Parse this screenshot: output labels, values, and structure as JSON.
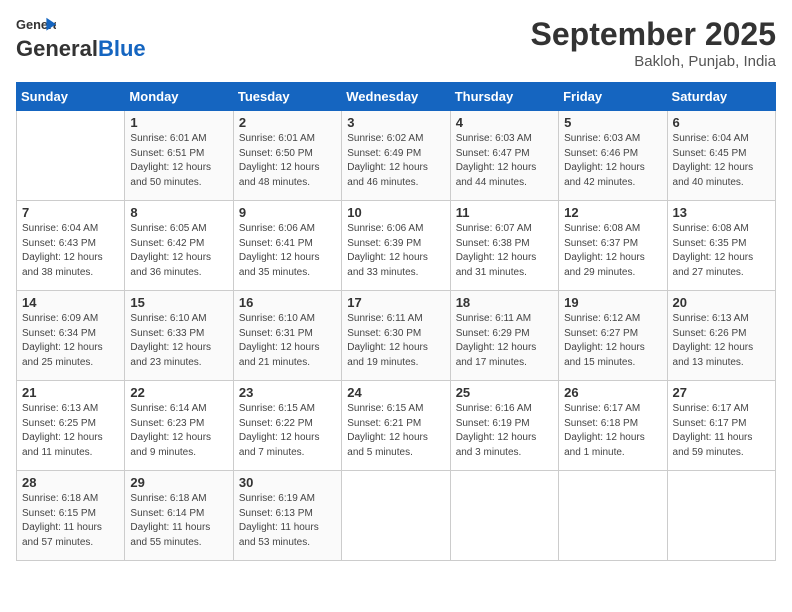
{
  "header": {
    "logo_general": "General",
    "logo_blue": "Blue",
    "month": "September 2025",
    "location": "Bakloh, Punjab, India"
  },
  "days_of_week": [
    "Sunday",
    "Monday",
    "Tuesday",
    "Wednesday",
    "Thursday",
    "Friday",
    "Saturday"
  ],
  "weeks": [
    [
      {
        "day": "",
        "info": ""
      },
      {
        "day": "1",
        "info": "Sunrise: 6:01 AM\nSunset: 6:51 PM\nDaylight: 12 hours\nand 50 minutes."
      },
      {
        "day": "2",
        "info": "Sunrise: 6:01 AM\nSunset: 6:50 PM\nDaylight: 12 hours\nand 48 minutes."
      },
      {
        "day": "3",
        "info": "Sunrise: 6:02 AM\nSunset: 6:49 PM\nDaylight: 12 hours\nand 46 minutes."
      },
      {
        "day": "4",
        "info": "Sunrise: 6:03 AM\nSunset: 6:47 PM\nDaylight: 12 hours\nand 44 minutes."
      },
      {
        "day": "5",
        "info": "Sunrise: 6:03 AM\nSunset: 6:46 PM\nDaylight: 12 hours\nand 42 minutes."
      },
      {
        "day": "6",
        "info": "Sunrise: 6:04 AM\nSunset: 6:45 PM\nDaylight: 12 hours\nand 40 minutes."
      }
    ],
    [
      {
        "day": "7",
        "info": "Sunrise: 6:04 AM\nSunset: 6:43 PM\nDaylight: 12 hours\nand 38 minutes."
      },
      {
        "day": "8",
        "info": "Sunrise: 6:05 AM\nSunset: 6:42 PM\nDaylight: 12 hours\nand 36 minutes."
      },
      {
        "day": "9",
        "info": "Sunrise: 6:06 AM\nSunset: 6:41 PM\nDaylight: 12 hours\nand 35 minutes."
      },
      {
        "day": "10",
        "info": "Sunrise: 6:06 AM\nSunset: 6:39 PM\nDaylight: 12 hours\nand 33 minutes."
      },
      {
        "day": "11",
        "info": "Sunrise: 6:07 AM\nSunset: 6:38 PM\nDaylight: 12 hours\nand 31 minutes."
      },
      {
        "day": "12",
        "info": "Sunrise: 6:08 AM\nSunset: 6:37 PM\nDaylight: 12 hours\nand 29 minutes."
      },
      {
        "day": "13",
        "info": "Sunrise: 6:08 AM\nSunset: 6:35 PM\nDaylight: 12 hours\nand 27 minutes."
      }
    ],
    [
      {
        "day": "14",
        "info": "Sunrise: 6:09 AM\nSunset: 6:34 PM\nDaylight: 12 hours\nand 25 minutes."
      },
      {
        "day": "15",
        "info": "Sunrise: 6:10 AM\nSunset: 6:33 PM\nDaylight: 12 hours\nand 23 minutes."
      },
      {
        "day": "16",
        "info": "Sunrise: 6:10 AM\nSunset: 6:31 PM\nDaylight: 12 hours\nand 21 minutes."
      },
      {
        "day": "17",
        "info": "Sunrise: 6:11 AM\nSunset: 6:30 PM\nDaylight: 12 hours\nand 19 minutes."
      },
      {
        "day": "18",
        "info": "Sunrise: 6:11 AM\nSunset: 6:29 PM\nDaylight: 12 hours\nand 17 minutes."
      },
      {
        "day": "19",
        "info": "Sunrise: 6:12 AM\nSunset: 6:27 PM\nDaylight: 12 hours\nand 15 minutes."
      },
      {
        "day": "20",
        "info": "Sunrise: 6:13 AM\nSunset: 6:26 PM\nDaylight: 12 hours\nand 13 minutes."
      }
    ],
    [
      {
        "day": "21",
        "info": "Sunrise: 6:13 AM\nSunset: 6:25 PM\nDaylight: 12 hours\nand 11 minutes."
      },
      {
        "day": "22",
        "info": "Sunrise: 6:14 AM\nSunset: 6:23 PM\nDaylight: 12 hours\nand 9 minutes."
      },
      {
        "day": "23",
        "info": "Sunrise: 6:15 AM\nSunset: 6:22 PM\nDaylight: 12 hours\nand 7 minutes."
      },
      {
        "day": "24",
        "info": "Sunrise: 6:15 AM\nSunset: 6:21 PM\nDaylight: 12 hours\nand 5 minutes."
      },
      {
        "day": "25",
        "info": "Sunrise: 6:16 AM\nSunset: 6:19 PM\nDaylight: 12 hours\nand 3 minutes."
      },
      {
        "day": "26",
        "info": "Sunrise: 6:17 AM\nSunset: 6:18 PM\nDaylight: 12 hours\nand 1 minute."
      },
      {
        "day": "27",
        "info": "Sunrise: 6:17 AM\nSunset: 6:17 PM\nDaylight: 11 hours\nand 59 minutes."
      }
    ],
    [
      {
        "day": "28",
        "info": "Sunrise: 6:18 AM\nSunset: 6:15 PM\nDaylight: 11 hours\nand 57 minutes."
      },
      {
        "day": "29",
        "info": "Sunrise: 6:18 AM\nSunset: 6:14 PM\nDaylight: 11 hours\nand 55 minutes."
      },
      {
        "day": "30",
        "info": "Sunrise: 6:19 AM\nSunset: 6:13 PM\nDaylight: 11 hours\nand 53 minutes."
      },
      {
        "day": "",
        "info": ""
      },
      {
        "day": "",
        "info": ""
      },
      {
        "day": "",
        "info": ""
      },
      {
        "day": "",
        "info": ""
      }
    ]
  ]
}
